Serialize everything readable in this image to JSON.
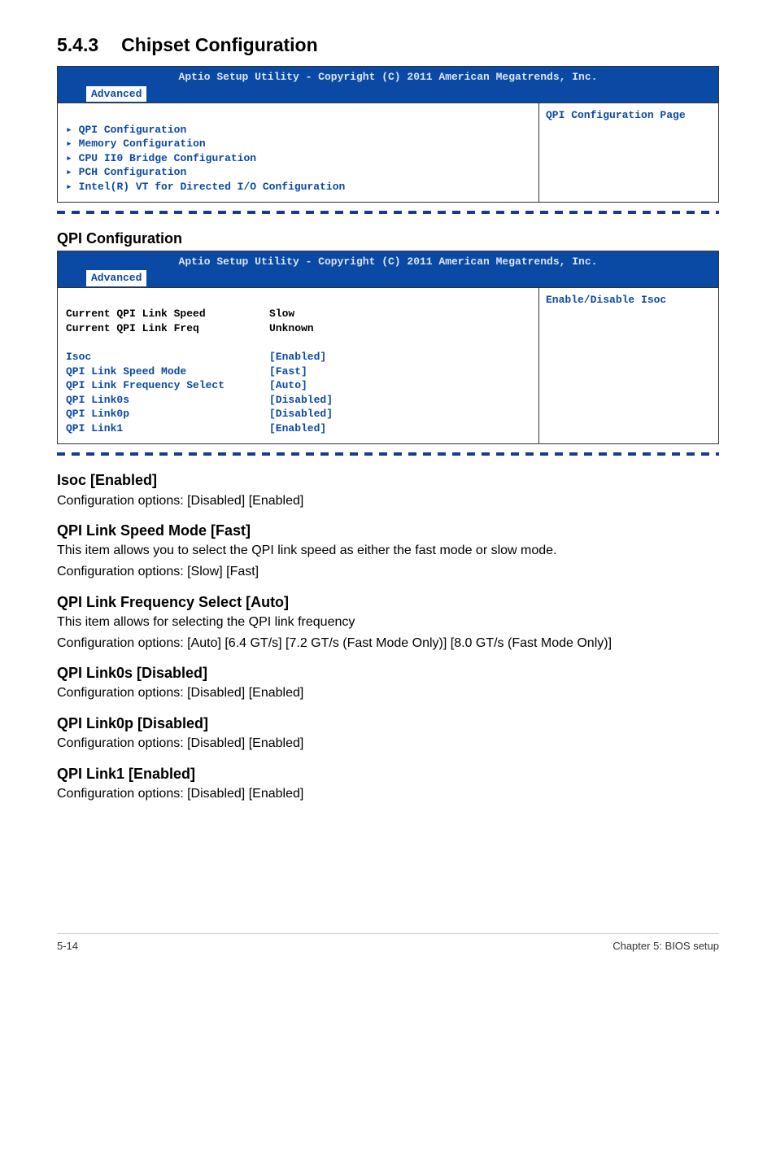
{
  "section": {
    "number": "5.4.3",
    "title": "Chipset Configuration"
  },
  "bios1": {
    "title": "Aptio Setup Utility - Copyright (C) 2011 American Megatrends, Inc.",
    "tab": "Advanced",
    "items": [
      "QPI Configuration",
      "Memory Configuration",
      "CPU II0 Bridge Configuration",
      "PCH Configuration",
      "Intel(R) VT for Directed I/O Configuration"
    ],
    "help": "QPI Configuration Page"
  },
  "qpi_heading": "QPI Configuration",
  "bios2": {
    "title": "Aptio Setup Utility - Copyright (C) 2011 American Megatrends, Inc.",
    "tab": "Advanced",
    "static_rows": [
      {
        "label": "Current QPI Link Speed",
        "value": "Slow"
      },
      {
        "label": "Current QPI Link Freq",
        "value": "Unknown"
      }
    ],
    "option_rows": [
      {
        "label": "Isoc",
        "value": "[Enabled]"
      },
      {
        "label": "QPI Link Speed Mode",
        "value": "[Fast]"
      },
      {
        "label": "QPI Link Frequency Select",
        "value": "[Auto]"
      },
      {
        "label": "QPI Link0s",
        "value": "[Disabled]"
      },
      {
        "label": "QPI Link0p",
        "value": "[Disabled]"
      },
      {
        "label": "QPI Link1",
        "value": "[Enabled]"
      }
    ],
    "help": "Enable/Disable Isoc"
  },
  "blocks": {
    "isoc": {
      "h": "Isoc [Enabled]",
      "p1": "Configuration options: [Disabled] [Enabled]"
    },
    "speed": {
      "h": "QPI Link Speed Mode [Fast]",
      "p1": "This item allows you to select the QPI link speed as either the fast mode or slow mode.",
      "p2": "Configuration options: [Slow] [Fast]"
    },
    "freq": {
      "h": "QPI Link Frequency Select [Auto]",
      "p1": "This item allows for selecting the QPI link frequency",
      "p2": "Configuration options: [Auto] [6.4 GT/s] [7.2 GT/s (Fast Mode Only)] [8.0 GT/s (Fast Mode Only)]"
    },
    "l0s": {
      "h": "QPI Link0s [Disabled]",
      "p1": "Configuration options: [Disabled] [Enabled]"
    },
    "l0p": {
      "h": "QPI Link0p [Disabled]",
      "p1": "Configuration options: [Disabled] [Enabled]"
    },
    "l1": {
      "h": "QPI Link1 [Enabled]",
      "p1": "Configuration options: [Disabled] [Enabled]"
    }
  },
  "footer": {
    "left": "5-14",
    "right": "Chapter 5: BIOS setup"
  }
}
